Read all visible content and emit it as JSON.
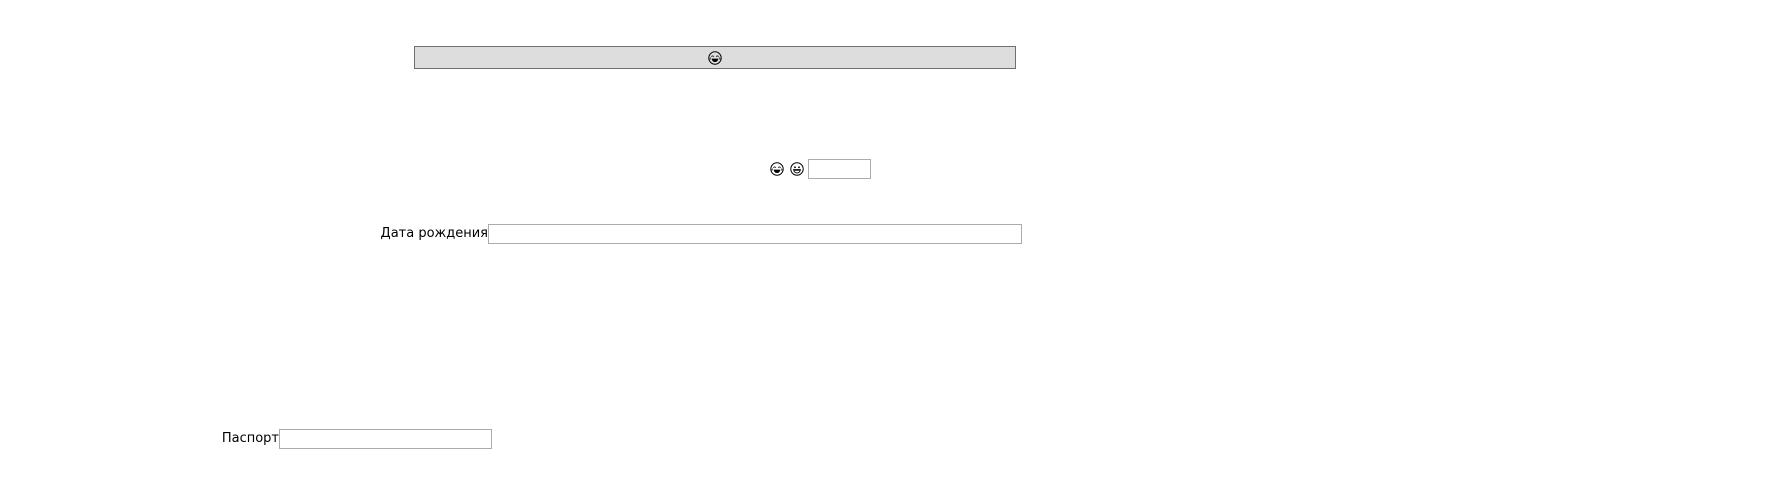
{
  "top_button": {
    "icon": "grinning-face-with-tears-icon"
  },
  "emoji_row": {
    "icons": [
      "grinning-face-with-tears-icon",
      "grinning-face-icon"
    ],
    "input_value": ""
  },
  "birth_date": {
    "label": "Дата рождения",
    "value": ""
  },
  "passport": {
    "label": "Паспорт",
    "value": ""
  }
}
